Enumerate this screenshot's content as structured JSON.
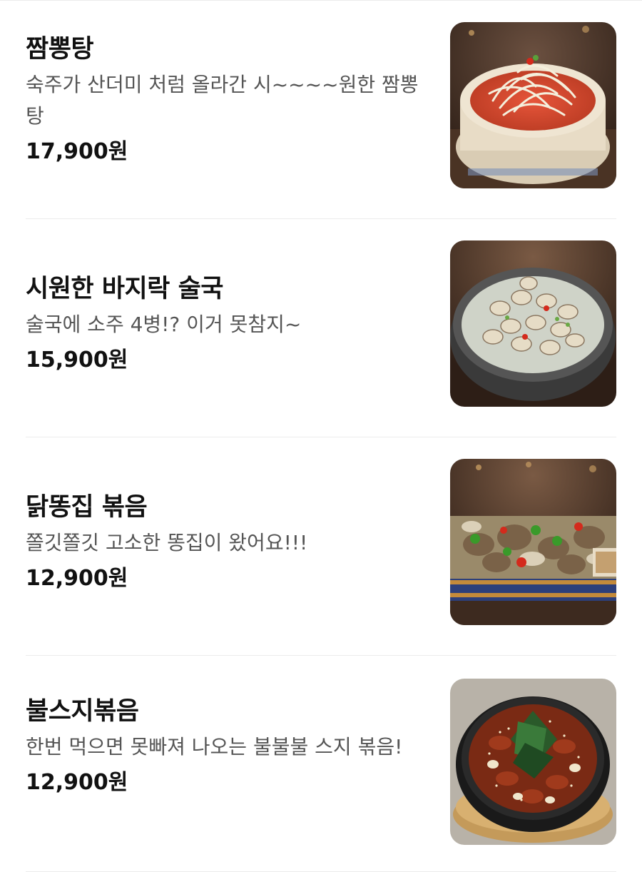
{
  "menu": {
    "items": [
      {
        "name": "짬뽕탕",
        "description": "숙주가 산더미 처럼 올라간 시~~~~원한 짬뽕탕",
        "price": "17,900원",
        "photo_icon": "jjamppong-soup-photo"
      },
      {
        "name": "시원한 바지락 술국",
        "description": "술국에 소주 4병!? 이거 못참지~",
        "price": "15,900원",
        "photo_icon": "clam-soup-photo"
      },
      {
        "name": "닭똥집 볶음",
        "description": "쫄깃쫄깃 고소한 똥집이 왔어요!!!",
        "price": "12,900원",
        "photo_icon": "chicken-gizzard-photo"
      },
      {
        "name": "불스지볶음",
        "description": "한번 먹으면 못빠져 나오는 불불불 스지 볶음!",
        "price": "12,900원",
        "photo_icon": "beef-tendon-stir-fry-photo"
      }
    ]
  }
}
